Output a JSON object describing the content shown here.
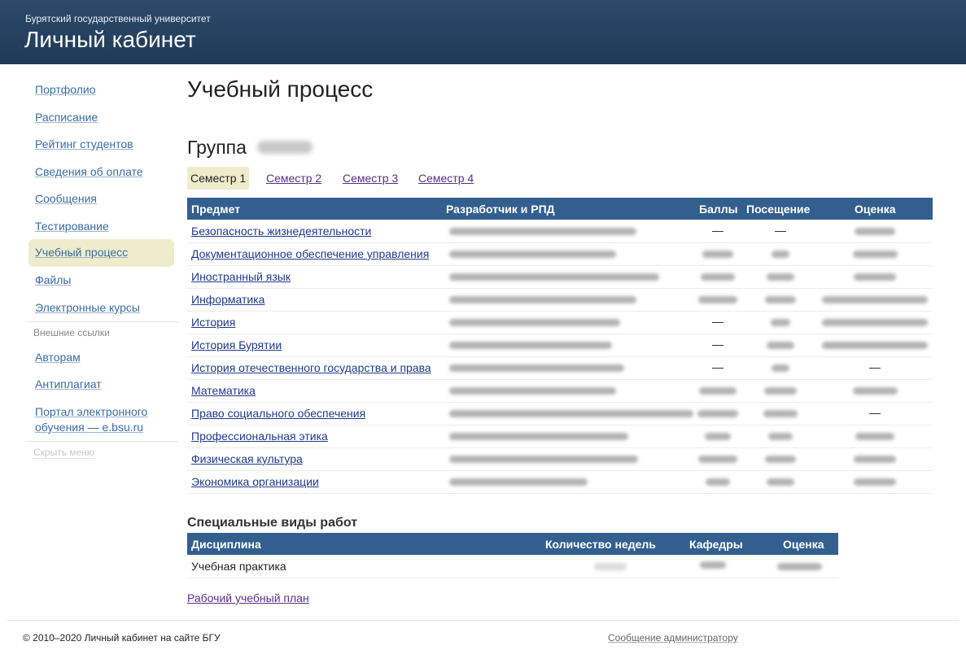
{
  "header": {
    "university": "Бурятский государственный университет",
    "title": "Личный кабинет"
  },
  "sidebar": {
    "items": [
      {
        "label": "Портфолио"
      },
      {
        "label": "Расписание"
      },
      {
        "label": "Рейтинг студентов"
      },
      {
        "label": "Сведения об оплате"
      },
      {
        "label": "Сообщения"
      },
      {
        "label": "Тестирование"
      },
      {
        "label": "Учебный процесс",
        "active": true
      },
      {
        "label": "Файлы"
      },
      {
        "label": "Электронные курсы"
      }
    ],
    "external_heading": "Внешние ссылки",
    "external": [
      {
        "label": "Авторам"
      },
      {
        "label": "Антиплагиат"
      },
      {
        "label": "Портал электронного обучения — e.bsu.ru"
      }
    ],
    "hide_menu": "Скрыть меню"
  },
  "main": {
    "title": "Учебный процесс",
    "group_label": "Группа",
    "tabs": [
      "Семестр 1",
      "Семестр 2",
      "Семестр 3",
      "Семестр 4"
    ],
    "active_tab": "Семестр 1",
    "table": {
      "headers": [
        "Предмет",
        "Разработчик и РПД",
        "Баллы",
        "Посещение",
        "Оценка"
      ],
      "dash": "—",
      "rows": [
        {
          "subject": "Безопасность жизнедеятельности"
        },
        {
          "subject": "Документационное обеспечение управления"
        },
        {
          "subject": "Иностранный язык"
        },
        {
          "subject": "Информатика"
        },
        {
          "subject": "История"
        },
        {
          "subject": "История Бурятии"
        },
        {
          "subject": "История отечественного государства и права"
        },
        {
          "subject": "Математика"
        },
        {
          "subject": "Право социального обеспечения"
        },
        {
          "subject": "Профессиональная этика"
        },
        {
          "subject": "Физическая культура"
        },
        {
          "subject": "Экономика организации"
        }
      ]
    },
    "special": {
      "title": "Специальные виды работ",
      "headers": [
        "Дисциплина",
        "Количество недель",
        "Кафедры",
        "Оценка"
      ],
      "rows": [
        {
          "discipline": "Учебная практика"
        }
      ]
    },
    "plan_link": "Рабочий учебный план"
  },
  "footer": {
    "copyright": "© 2010–2020 Личный кабинет на сайте БГУ",
    "admin_link": "Сообщение администратору"
  }
}
